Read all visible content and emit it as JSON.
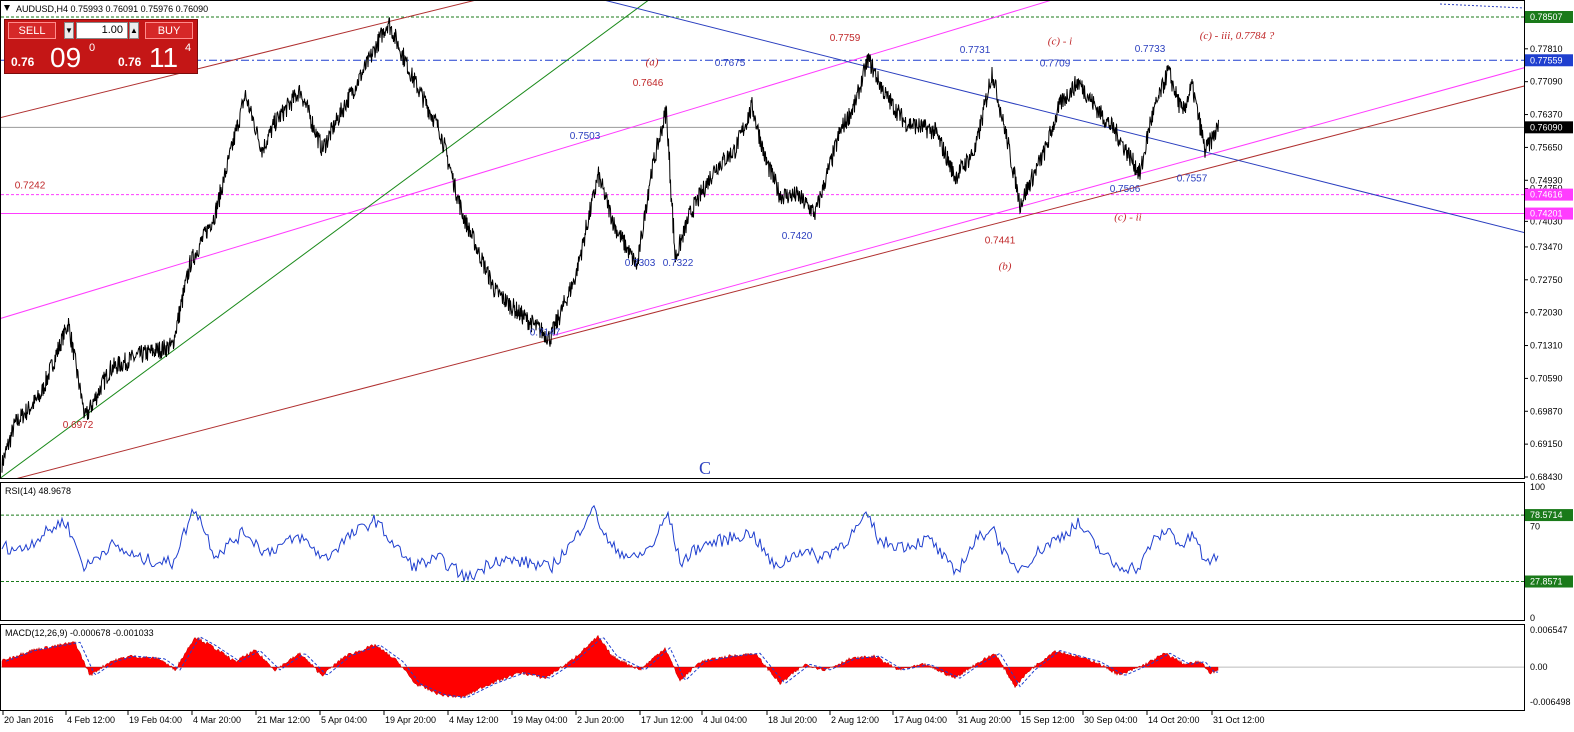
{
  "window": {
    "title": "AUDUSD,H4  0.75993 0.76091 0.75976 0.76090"
  },
  "trade_panel": {
    "sell_label": "SELL",
    "buy_label": "BUY",
    "lot": "1.00",
    "sell_price_prefix": "0.76",
    "sell_price_big": "09",
    "sell_price_sup": "0",
    "buy_price_prefix": "0.76",
    "buy_price_big": "11",
    "buy_price_sup": "4"
  },
  "main_axis": {
    "ticks": [
      "0.77810",
      "0.77090",
      "0.76370",
      "0.75650",
      "0.74930",
      "0.74750",
      "0.74030",
      "0.73470",
      "0.72750",
      "0.72030",
      "0.71310",
      "0.70590",
      "0.69870",
      "0.69150",
      "0.68430"
    ],
    "tags": [
      {
        "text": "0.78507",
        "bg": "#1a7a1a",
        "fg": "#ffffff",
        "price": 0.78507
      },
      {
        "text": "0.77559",
        "bg": "#1f3fcf",
        "fg": "#ffffff",
        "price": 0.77559
      },
      {
        "text": "0.76090",
        "bg": "#000000",
        "fg": "#ffffff",
        "price": 0.7609
      },
      {
        "text": "0.74616",
        "bg": "#ff3cff",
        "fg": "#ffffff",
        "price": 0.74616
      },
      {
        "text": "0.74201",
        "bg": "#ff3cff",
        "fg": "#ffffff",
        "price": 0.74201
      }
    ]
  },
  "annotations": [
    {
      "text": "0.7759",
      "color": "#c0282a",
      "price": 0.7798,
      "bar": 845,
      "style": "num"
    },
    {
      "text": "0.7731",
      "color": "#2b3fbf",
      "price": 0.7772,
      "bar": 975,
      "style": "num"
    },
    {
      "text": "0.7733",
      "color": "#2b3fbf",
      "price": 0.7774,
      "bar": 1150,
      "style": "num"
    },
    {
      "text": "0.7675",
      "color": "#2b3fbf",
      "price": 0.7743,
      "bar": 730,
      "style": "num"
    },
    {
      "text": "0.7709",
      "color": "#2b3fbf",
      "price": 0.7742,
      "bar": 1055,
      "style": "num"
    },
    {
      "text": "0.7646",
      "color": "#c0282a",
      "price": 0.77,
      "bar": 648,
      "style": "num"
    },
    {
      "text": "0.7503",
      "color": "#2b3fbf",
      "price": 0.7583,
      "bar": 585,
      "style": "num"
    },
    {
      "text": "0.7242",
      "color": "#c0282a",
      "price": 0.7475,
      "bar": 30,
      "style": "num"
    },
    {
      "text": "0.7557",
      "color": "#2b3fbf",
      "price": 0.749,
      "bar": 1192,
      "style": "num"
    },
    {
      "text": "0.7506",
      "color": "#2b3fbf",
      "price": 0.7467,
      "bar": 1125,
      "style": "num"
    },
    {
      "text": "0.7420",
      "color": "#2b3fbf",
      "price": 0.7364,
      "bar": 797,
      "style": "num"
    },
    {
      "text": "0.7441",
      "color": "#c0282a",
      "price": 0.7355,
      "bar": 1000,
      "style": "num"
    },
    {
      "text": "0.7303",
      "color": "#2b3fbf",
      "price": 0.7305,
      "bar": 640,
      "style": "num"
    },
    {
      "text": "0.7322",
      "color": "#2b3fbf",
      "price": 0.7305,
      "bar": 678,
      "style": "num"
    },
    {
      "text": "0.7147",
      "color": "#2b3fbf",
      "price": 0.7153,
      "bar": 545,
      "style": "num"
    },
    {
      "text": "0.6972",
      "color": "#c0282a",
      "price": 0.695,
      "bar": 78,
      "style": "num"
    },
    {
      "text": "(a)",
      "color": "#c0282a",
      "price": 0.7745,
      "bar": 652,
      "style": "wave"
    },
    {
      "text": "(c) - i",
      "color": "#c0282a",
      "price": 0.779,
      "bar": 1060,
      "style": "wave"
    },
    {
      "text": "(c) - iii, 0.7784 ?",
      "color": "#c0282a",
      "price": 0.7802,
      "bar": 1237,
      "style": "wave"
    },
    {
      "text": "(c) - ii",
      "color": "#c0282a",
      "price": 0.7405,
      "bar": 1128,
      "style": "wave"
    },
    {
      "text": "(b)",
      "color": "#c0282a",
      "price": 0.7298,
      "bar": 1005,
      "style": "wave"
    },
    {
      "text": "C",
      "color": "#2b3fbf",
      "price": 0.685,
      "bar": 705,
      "style": "big"
    }
  ],
  "rsi": {
    "label": "RSI(14) 48.9678",
    "ticks": [
      "100",
      "70",
      "0"
    ],
    "tags": [
      {
        "text": "78.5714",
        "bg": "#1a7a1a",
        "fg": "#ffffff",
        "value": 78.5714
      },
      {
        "text": "27.8571",
        "bg": "#1a7a1a",
        "fg": "#ffffff",
        "value": 27.8571
      }
    ]
  },
  "macd": {
    "label": "MACD(12,26,9) -0.000678 -0.001033",
    "ticks": [
      "0.006547",
      "0.00",
      "-0.006498"
    ]
  },
  "time_axis": [
    "20 Jan 2016",
    "4 Feb 12:00",
    "19 Feb 04:00",
    "4 Mar 20:00",
    "21 Mar 12:00",
    "5 Apr 04:00",
    "19 Apr 20:00",
    "4 May 12:00",
    "19 May 04:00",
    "2 Jun 20:00",
    "17 Jun 12:00",
    "4 Jul 04:00",
    "18 Jul 20:00",
    "2 Aug 12:00",
    "17 Aug 04:00",
    "31 Aug 20:00",
    "15 Sep 12:00",
    "30 Sep 04:00",
    "14 Oct 20:00",
    "31 Oct 12:00"
  ],
  "chart_data": {
    "type": "line",
    "title": "AUDUSD,H4  0.75993 0.76091 0.75976 0.76090",
    "x": [
      "20 Jan 2016",
      "4 Feb 12:00",
      "19 Feb 04:00",
      "4 Mar 20:00",
      "21 Mar 12:00",
      "5 Apr 04:00",
      "19 Apr 20:00",
      "4 May 12:00",
      "19 May 04:00",
      "2 Jun 20:00",
      "17 Jun 12:00",
      "4 Jul 04:00",
      "18 Jul 20:00",
      "2 Aug 12:00",
      "17 Aug 04:00",
      "31 Aug 20:00",
      "15 Sep 12:00",
      "30 Sep 04:00",
      "14 Oct 20:00",
      "31 Oct 12:00"
    ],
    "price_path": [
      [
        0,
        0.686
      ],
      [
        15,
        0.696
      ],
      [
        40,
        0.702
      ],
      [
        68,
        0.718
      ],
      [
        85,
        0.6972
      ],
      [
        110,
        0.708
      ],
      [
        140,
        0.711
      ],
      [
        172,
        0.713
      ],
      [
        190,
        0.731
      ],
      [
        215,
        0.742
      ],
      [
        245,
        0.768
      ],
      [
        262,
        0.756
      ],
      [
        275,
        0.762
      ],
      [
        300,
        0.769
      ],
      [
        322,
        0.756
      ],
      [
        345,
        0.766
      ],
      [
        370,
        0.776
      ],
      [
        388,
        0.784
      ],
      [
        400,
        0.778
      ],
      [
        412,
        0.772
      ],
      [
        440,
        0.76
      ],
      [
        462,
        0.742
      ],
      [
        495,
        0.725
      ],
      [
        520,
        0.72
      ],
      [
        550,
        0.7147
      ],
      [
        575,
        0.728
      ],
      [
        598,
        0.7503
      ],
      [
        615,
        0.739
      ],
      [
        637,
        0.7303
      ],
      [
        650,
        0.75
      ],
      [
        666,
        0.7646
      ],
      [
        675,
        0.7322
      ],
      [
        690,
        0.742
      ],
      [
        715,
        0.752
      ],
      [
        735,
        0.756
      ],
      [
        752,
        0.7655
      ],
      [
        765,
        0.754
      ],
      [
        780,
        0.746
      ],
      [
        797,
        0.746
      ],
      [
        815,
        0.742
      ],
      [
        840,
        0.76
      ],
      [
        855,
        0.766
      ],
      [
        868,
        0.7759
      ],
      [
        885,
        0.768
      ],
      [
        905,
        0.762
      ],
      [
        935,
        0.76
      ],
      [
        955,
        0.75
      ],
      [
        975,
        0.756
      ],
      [
        992,
        0.7731
      ],
      [
        1005,
        0.76
      ],
      [
        1020,
        0.7441
      ],
      [
        1045,
        0.756
      ],
      [
        1060,
        0.766
      ],
      [
        1078,
        0.7709
      ],
      [
        1100,
        0.764
      ],
      [
        1115,
        0.76
      ],
      [
        1140,
        0.7506
      ],
      [
        1150,
        0.762
      ],
      [
        1168,
        0.7733
      ],
      [
        1182,
        0.764
      ],
      [
        1192,
        0.77
      ],
      [
        1205,
        0.7557
      ],
      [
        1218,
        0.7609
      ]
    ],
    "levels": [
      {
        "name": "0.78507",
        "value": 0.78507
      },
      {
        "name": "0.77559",
        "value": 0.77559
      },
      {
        "name": "0.76090",
        "value": 0.7609
      },
      {
        "name": "0.74616",
        "value": 0.74616
      },
      {
        "name": "0.74201",
        "value": 0.74201
      }
    ],
    "trendlines": [
      {
        "color": "#b03030",
        "p1": [
          0,
          0.763
        ],
        "p2": [
          480,
          0.789
        ]
      },
      {
        "color": "#b03030",
        "p1": [
          0,
          0.683
        ],
        "p2": [
          1525,
          0.77
        ]
      },
      {
        "color": "#ff3cff",
        "p1": [
          0,
          0.719
        ],
        "p2": [
          1055,
          0.789
        ]
      },
      {
        "color": "#ff3cff",
        "p1": [
          553,
          0.7153
        ],
        "p2": [
          1525,
          0.774
        ]
      },
      {
        "color": "#1a8a1a",
        "p1": [
          0,
          0.684
        ],
        "p2": [
          650,
          0.789
        ]
      },
      {
        "color": "#2b3fbf",
        "p1": [
          600,
          0.789
        ],
        "p2": [
          1525,
          0.7378
        ]
      }
    ],
    "ylim": [
      0.6843,
      0.78507
    ]
  },
  "rsi_data": {
    "overbought": 78.5714,
    "oversold": 27.8571,
    "last": 48.9678,
    "ylim": [
      0,
      100
    ],
    "path": [
      [
        0,
        55
      ],
      [
        20,
        52
      ],
      [
        40,
        62
      ],
      [
        65,
        75
      ],
      [
        85,
        38
      ],
      [
        110,
        56
      ],
      [
        140,
        45
      ],
      [
        172,
        42
      ],
      [
        195,
        85
      ],
      [
        215,
        48
      ],
      [
        245,
        66
      ],
      [
        265,
        50
      ],
      [
        300,
        62
      ],
      [
        325,
        45
      ],
      [
        345,
        60
      ],
      [
        375,
        75
      ],
      [
        395,
        55
      ],
      [
        412,
        40
      ],
      [
        440,
        45
      ],
      [
        468,
        30
      ],
      [
        495,
        45
      ],
      [
        530,
        42
      ],
      [
        550,
        38
      ],
      [
        575,
        60
      ],
      [
        592,
        85
      ],
      [
        610,
        55
      ],
      [
        635,
        45
      ],
      [
        652,
        55
      ],
      [
        668,
        80
      ],
      [
        680,
        42
      ],
      [
        700,
        55
      ],
      [
        735,
        62
      ],
      [
        752,
        65
      ],
      [
        775,
        38
      ],
      [
        800,
        52
      ],
      [
        820,
        46
      ],
      [
        845,
        58
      ],
      [
        868,
        78
      ],
      [
        880,
        58
      ],
      [
        905,
        55
      ],
      [
        930,
        60
      ],
      [
        955,
        34
      ],
      [
        975,
        58
      ],
      [
        992,
        70
      ],
      [
        1010,
        40
      ],
      [
        1020,
        38
      ],
      [
        1045,
        55
      ],
      [
        1060,
        62
      ],
      [
        1078,
        72
      ],
      [
        1095,
        56
      ],
      [
        1115,
        40
      ],
      [
        1140,
        38
      ],
      [
        1150,
        56
      ],
      [
        1168,
        68
      ],
      [
        1182,
        55
      ],
      [
        1195,
        64
      ],
      [
        1205,
        40
      ],
      [
        1218,
        48.97
      ]
    ]
  },
  "macd_data": {
    "last_main": -0.000678,
    "last_signal": -0.001033,
    "ylim": [
      -0.006498,
      0.006547
    ],
    "path": [
      [
        0,
        0.001
      ],
      [
        30,
        0.003
      ],
      [
        60,
        0.004
      ],
      [
        75,
        0.0045
      ],
      [
        90,
        -0.0015
      ],
      [
        110,
        0.001
      ],
      [
        130,
        0.002
      ],
      [
        160,
        0.0015
      ],
      [
        175,
        -0.0005
      ],
      [
        195,
        0.0055
      ],
      [
        210,
        0.004
      ],
      [
        235,
        0.001
      ],
      [
        255,
        0.003
      ],
      [
        275,
        -0.0005
      ],
      [
        300,
        0.0025
      ],
      [
        322,
        -0.0015
      ],
      [
        345,
        0.002
      ],
      [
        375,
        0.004
      ],
      [
        398,
        0.001
      ],
      [
        415,
        -0.003
      ],
      [
        440,
        -0.005
      ],
      [
        462,
        -0.0055
      ],
      [
        490,
        -0.003
      ],
      [
        520,
        -0.001
      ],
      [
        545,
        -0.002
      ],
      [
        570,
        0.001
      ],
      [
        598,
        0.0055
      ],
      [
        612,
        0.002
      ],
      [
        640,
        -0.0005
      ],
      [
        665,
        0.0035
      ],
      [
        680,
        -0.0025
      ],
      [
        700,
        0.001
      ],
      [
        730,
        0.002
      ],
      [
        755,
        0.0025
      ],
      [
        780,
        -0.003
      ],
      [
        805,
        0.0005
      ],
      [
        825,
        -0.0005
      ],
      [
        850,
        0.0015
      ],
      [
        875,
        0.002
      ],
      [
        898,
        -0.0005
      ],
      [
        925,
        0.0005
      ],
      [
        955,
        -0.002
      ],
      [
        975,
        0.0005
      ],
      [
        995,
        0.0025
      ],
      [
        1015,
        -0.0035
      ],
      [
        1030,
        -0.0005
      ],
      [
        1055,
        0.003
      ],
      [
        1075,
        0.002
      ],
      [
        1095,
        0.001
      ],
      [
        1120,
        -0.0015
      ],
      [
        1145,
        0.0005
      ],
      [
        1165,
        0.0025
      ],
      [
        1185,
        0.0005
      ],
      [
        1200,
        0.001
      ],
      [
        1210,
        -0.001
      ],
      [
        1218,
        -0.0007
      ]
    ]
  }
}
